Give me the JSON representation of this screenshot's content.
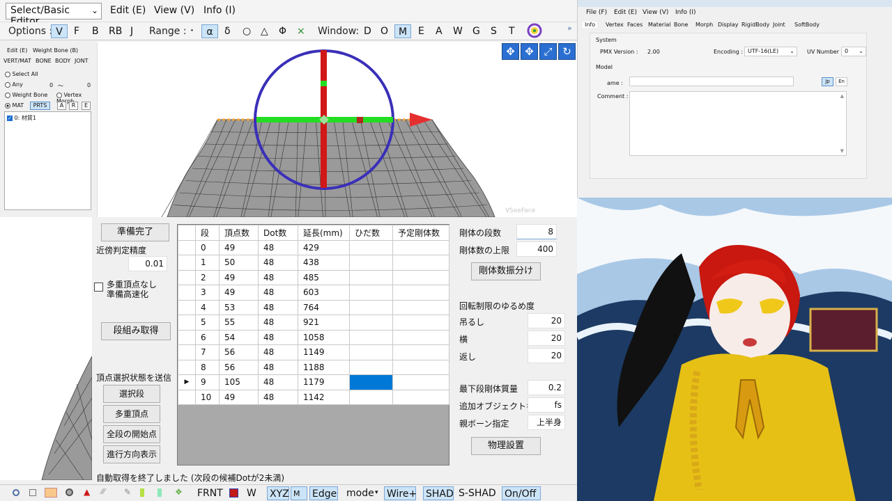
{
  "menubar": {
    "editor_select": "Select/Basic Editor",
    "items": [
      "Edit (E)",
      "View (V)",
      "Info (I)"
    ]
  },
  "toolbar": {
    "options_label": "Options :",
    "options": [
      "V",
      "F",
      "B",
      "RB",
      "J"
    ],
    "range_label": "Range :",
    "range": [
      "･",
      "α",
      "δ",
      "○",
      "△",
      "Φ",
      "×"
    ],
    "window_label": "Window:",
    "window": [
      "D",
      "O",
      "M",
      "E",
      "A",
      "W",
      "G",
      "S",
      "T"
    ]
  },
  "leftpanel": {
    "menu": [
      "Edit (E)",
      "Weight Bone (B)"
    ],
    "tabs": [
      "VERT/MAT",
      "BONE",
      "BODY",
      "JONT"
    ],
    "select_all": "Select All",
    "any": "Any",
    "any_from": "0",
    "any_tilde": "〜",
    "any_to": "0",
    "weight_bone": "Weight Bone",
    "vertex_morph": "Vertex Morph",
    "mat": "MAT",
    "prts": "PRTS",
    "a": "A",
    "r": "R",
    "e": "E",
    "material_item": "0: 材質1"
  },
  "viewport": {
    "watermark": "VSeeFace",
    "colors": {
      "ring": "#3a2fb8",
      "y_axis": "#d01818",
      "x_axis": "#22dd22",
      "arrow": "#e53030",
      "mesh": "#7d7d7d"
    }
  },
  "dialog": {
    "ready_button": "準備完了",
    "approx_label": "近傍判定精度",
    "approx_value": "0.01",
    "multi_vertex_label_1": "多重頂点なし",
    "multi_vertex_label_2": "準備高速化",
    "get_rows_button": "段組み取得",
    "send_label": "頂点選択状態を送信",
    "select_row_button": "選択段",
    "multi_vertex_button": "多重頂点",
    "all_start_button": "全段の開始点",
    "direction_button": "進行方向表示",
    "status_message": "自動取得を終了しました (次段の候補Dotが2未満)",
    "grid_columns": [
      "段",
      "頂点数",
      "Dot数",
      "延長(mm)",
      "ひだ数",
      "予定剛体数"
    ],
    "grid_rows": [
      [
        "0",
        "49",
        "48",
        "429",
        "",
        ""
      ],
      [
        "1",
        "50",
        "48",
        "438",
        "",
        ""
      ],
      [
        "2",
        "49",
        "48",
        "485",
        "",
        ""
      ],
      [
        "3",
        "49",
        "48",
        "603",
        "",
        ""
      ],
      [
        "4",
        "53",
        "48",
        "764",
        "",
        ""
      ],
      [
        "5",
        "55",
        "48",
        "921",
        "",
        ""
      ],
      [
        "6",
        "54",
        "48",
        "1058",
        "",
        ""
      ],
      [
        "7",
        "56",
        "48",
        "1149",
        "",
        ""
      ],
      [
        "8",
        "56",
        "48",
        "1188",
        "",
        ""
      ],
      [
        "9",
        "105",
        "48",
        "1179",
        "",
        ""
      ],
      [
        "10",
        "49",
        "48",
        "1142",
        "",
        ""
      ]
    ],
    "current_row_marker": "▶",
    "body_rows_label": "剛体の段数",
    "body_rows_value": "8",
    "body_max_label": "剛体数の上限",
    "body_max_value": "400",
    "distribute_button": "剛体数振分け",
    "rotation_label": "回転制限のゆるめ度",
    "hang_label": "吊るし",
    "hang_value": "20",
    "side_label": "横",
    "side_value": "20",
    "back_label": "返し",
    "back_value": "20",
    "lowest_mass_label": "最下段剛体質量",
    "lowest_mass_value": "0.2",
    "extra_object_label": "追加オブジェクト名称",
    "extra_object_value": "fs",
    "parent_bone_label": "親ボーン指定",
    "parent_bone_value": "上半身",
    "physics_button": "物理設置"
  },
  "bottombar": {
    "items": [
      "FRNT",
      "W",
      "XYZ",
      "Edge",
      "mode",
      "Wire+",
      "SHAD",
      "S-SHAD",
      "On/Off"
    ],
    "m_label": "M"
  },
  "infowin": {
    "menu": [
      "File (F)",
      "Edit (E)",
      "View (V)",
      "Info (I)"
    ],
    "tabs": [
      "Info",
      "Vertex",
      "Faces",
      "Material",
      "Bone",
      "Morph",
      "Display",
      "RigidBody",
      "Joint",
      "SoftBody"
    ],
    "system_label": "System",
    "pmx_version_label": "PMX Version :",
    "pmx_version": "2.00",
    "encoding_label": "Encoding :",
    "encoding": "UTF-16(LE)",
    "uv_number_label": "UV Number :",
    "uv_number": "0",
    "model_label": "Model",
    "name_label": "ame :",
    "comment_label": "Comment :",
    "jp": "Jp",
    "en": "En"
  }
}
